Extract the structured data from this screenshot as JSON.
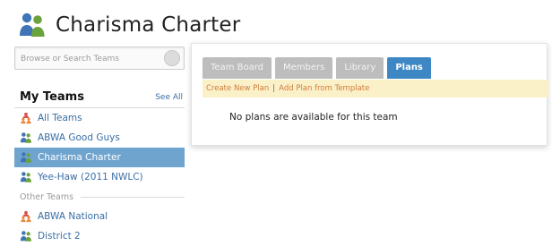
{
  "header": {
    "title": "Charisma Charter",
    "icon": "team-people-icon"
  },
  "sidebar": {
    "search": {
      "placeholder": "Browse or Search Teams"
    },
    "my_teams_heading": "My Teams",
    "see_all": "See All",
    "my_teams": [
      {
        "label": "All Teams",
        "icon": "all-teams-icon",
        "selected": false
      },
      {
        "label": "ABWA Good Guys",
        "icon": "team-people-icon",
        "selected": false
      },
      {
        "label": "Charisma Charter",
        "icon": "team-people-icon",
        "selected": true
      },
      {
        "label": "Yee-Haw (2011 NWLC)",
        "icon": "team-people-icon",
        "selected": false
      }
    ],
    "other_teams_label": "Other Teams",
    "other_teams": [
      {
        "label": "ABWA National",
        "icon": "all-teams-icon"
      },
      {
        "label": "District 2",
        "icon": "team-people-icon"
      }
    ]
  },
  "main": {
    "tabs": [
      {
        "label": "Team Board",
        "active": false
      },
      {
        "label": "Members",
        "active": false
      },
      {
        "label": "Library",
        "active": false
      },
      {
        "label": "Plans",
        "active": true
      }
    ],
    "actions": {
      "create_new_plan": "Create New Plan",
      "separator": "|",
      "add_plan_template": "Add Plan from Template"
    },
    "empty_message": "No plans are available for this team"
  },
  "colors": {
    "selected_bg": "#6fa4cf",
    "active_tab": "#3d87c4",
    "inactive_tab": "#bdbdbd",
    "link": "#3a6ea5",
    "action_bar_bg": "#fbf1c8",
    "action_link": "#d07b3a"
  }
}
